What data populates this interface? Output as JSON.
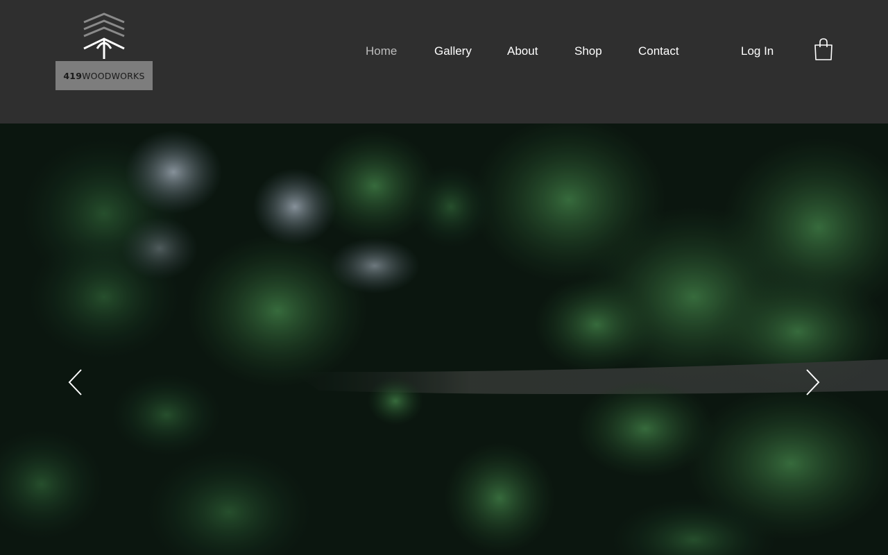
{
  "brand": {
    "logo_number": "419",
    "logo_word": "WOODWORKS"
  },
  "nav": {
    "items": [
      {
        "label": "Home",
        "active": true
      },
      {
        "label": "Gallery",
        "active": false
      },
      {
        "label": "About",
        "active": false
      },
      {
        "label": "Shop",
        "active": false
      },
      {
        "label": "Contact",
        "active": false
      }
    ],
    "login_label": "Log In",
    "cart_icon": "shopping-bag-icon"
  },
  "hero": {
    "image_subject": "aerial view of dark pine forest with a dirt road",
    "prev_icon": "chevron-left-icon",
    "next_icon": "chevron-right-icon"
  },
  "colors": {
    "header_bg": "#2f2f2f",
    "nav_text": "#ffffff",
    "nav_active": "#bdbdbd",
    "logo_box": "#7d7d7d"
  }
}
